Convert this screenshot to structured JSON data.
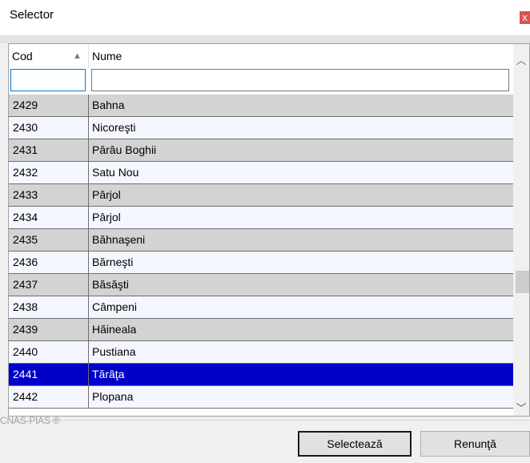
{
  "window": {
    "title": "Selector",
    "close_glyph": "x"
  },
  "grid": {
    "columns": [
      {
        "label": "Cod",
        "sort_icon": "sort-ascending-icon"
      },
      {
        "label": "Nume"
      }
    ],
    "filter": {
      "cod_value": "",
      "nume_value": ""
    },
    "rows": [
      {
        "cod": "2429",
        "nume": "Bahna"
      },
      {
        "cod": "2430",
        "nume": "Nicoreşti"
      },
      {
        "cod": "2431",
        "nume": "Pârâu Boghii"
      },
      {
        "cod": "2432",
        "nume": "Satu Nou"
      },
      {
        "cod": "2433",
        "nume": "Pârjol"
      },
      {
        "cod": "2434",
        "nume": "Pârjol"
      },
      {
        "cod": "2435",
        "nume": "Băhnaşeni"
      },
      {
        "cod": "2436",
        "nume": "Bărneşti"
      },
      {
        "cod": "2437",
        "nume": "Băsăşti"
      },
      {
        "cod": "2438",
        "nume": "Câmpeni"
      },
      {
        "cod": "2439",
        "nume": "Hăineala"
      },
      {
        "cod": "2440",
        "nume": "Pustiana"
      },
      {
        "cod": "2441",
        "nume": "Tărâţa",
        "selected": true
      },
      {
        "cod": "2442",
        "nume": "Plopana"
      }
    ]
  },
  "footer": {
    "brand": "CNAS-PIAS ®"
  },
  "buttons": {
    "select": "Selectează",
    "cancel": "Renunţă"
  },
  "colors": {
    "row_alt": "#d3d3d3",
    "row_light": "#f4f7ff",
    "selection": "#0000c8",
    "close": "#d9534f"
  }
}
